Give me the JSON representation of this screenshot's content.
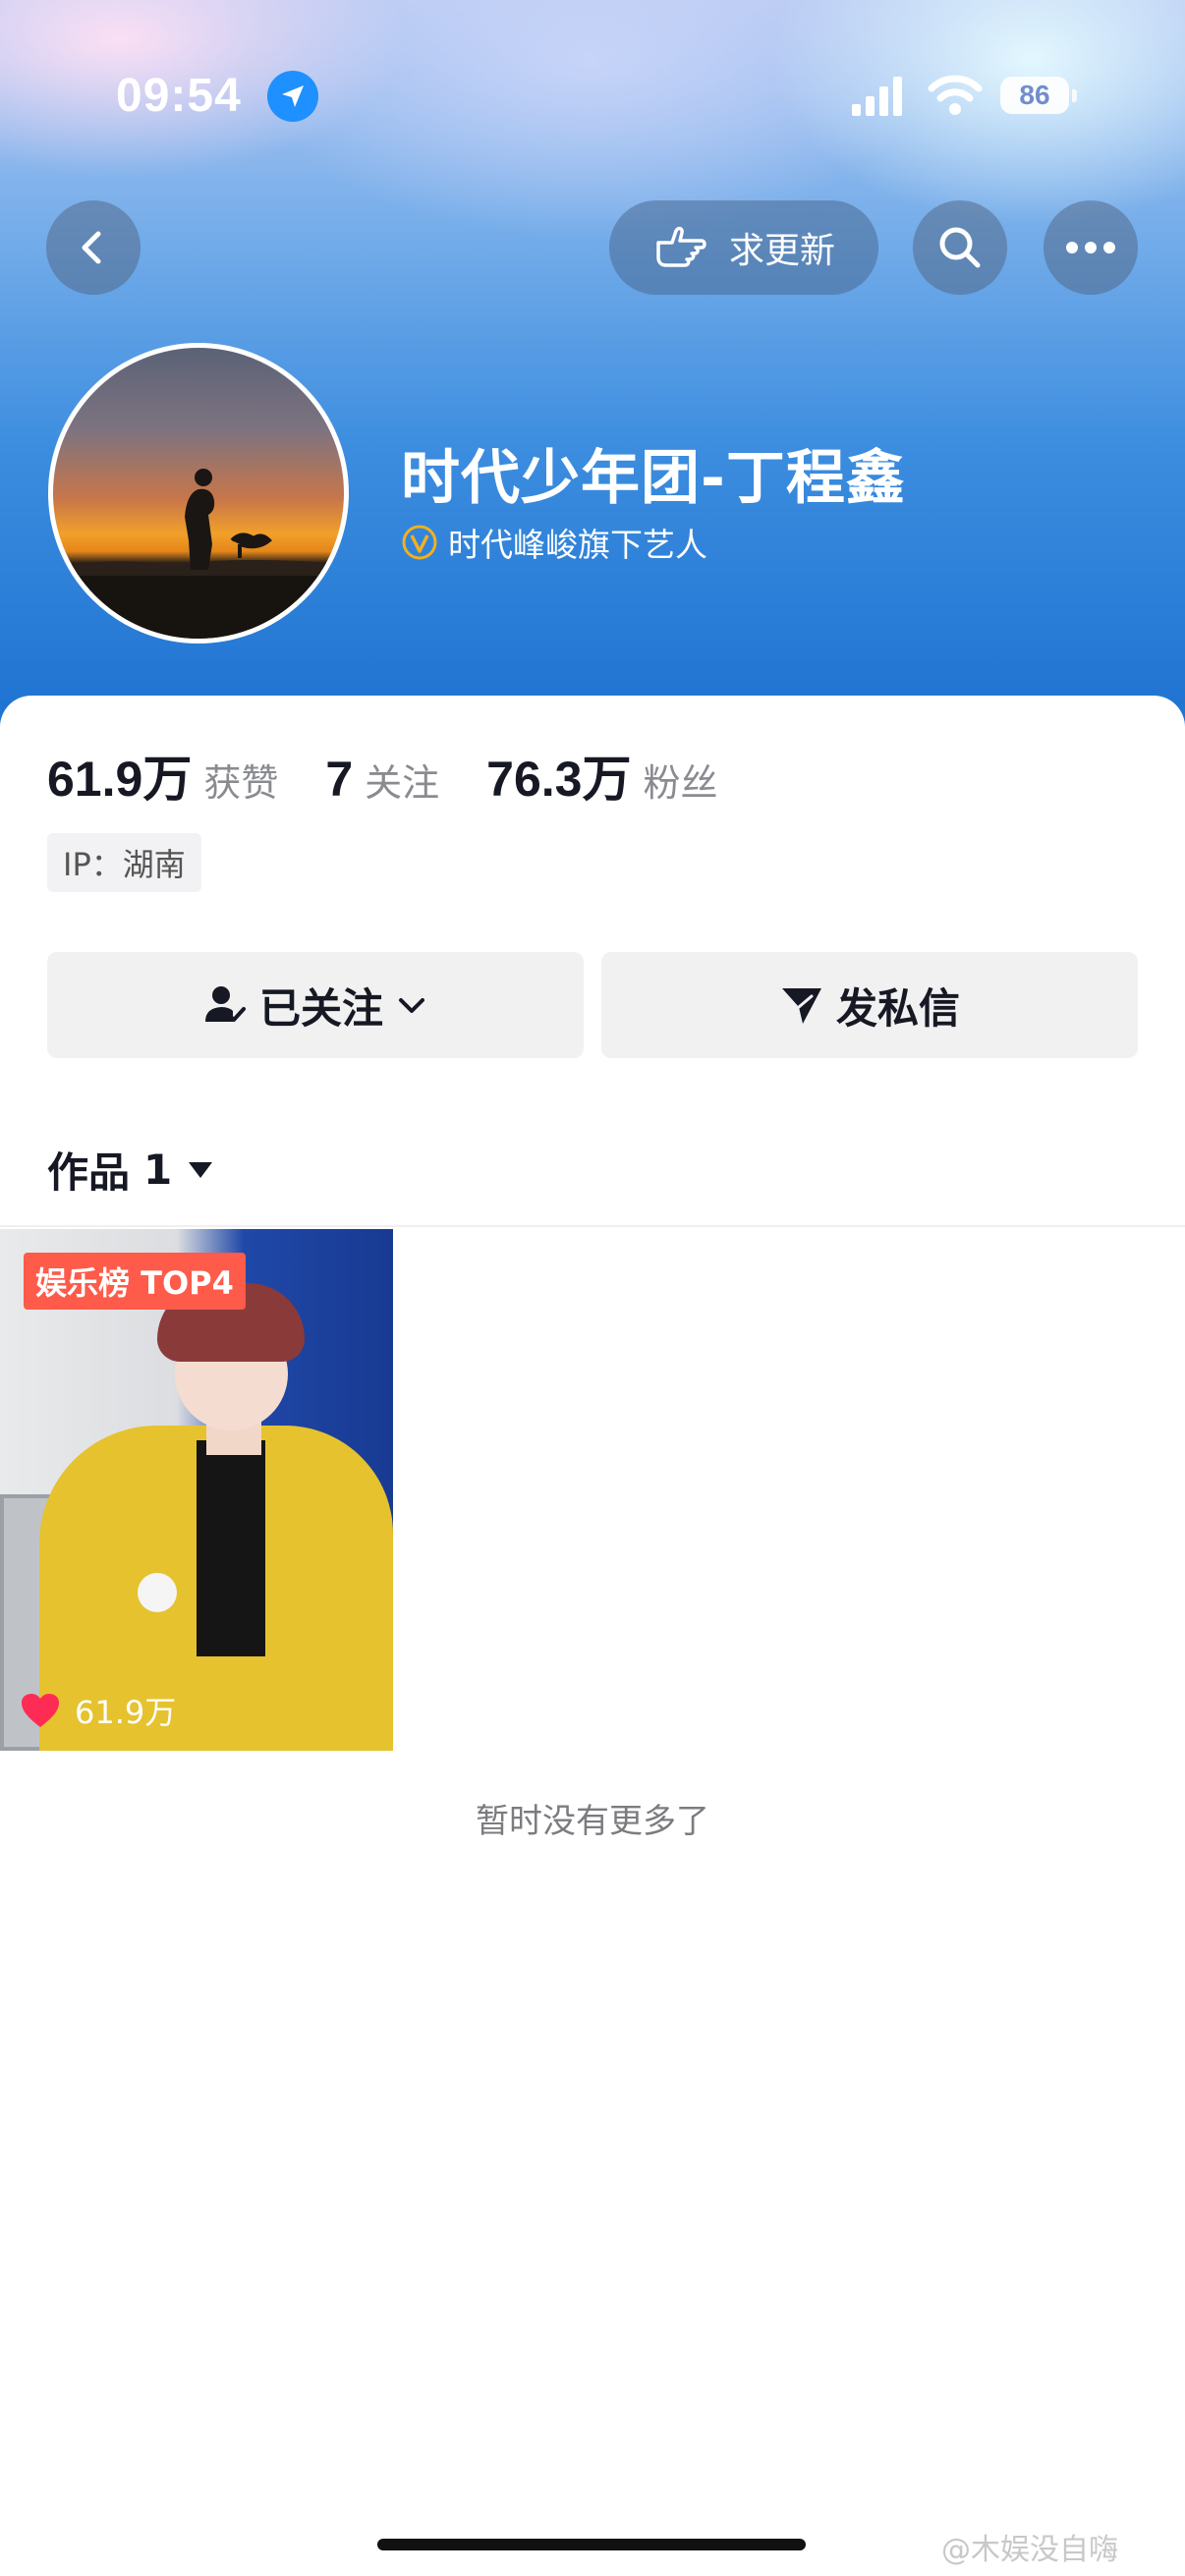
{
  "status_bar": {
    "time": "09:54",
    "battery": "86"
  },
  "top_bar": {
    "request_update_label": "求更新"
  },
  "profile": {
    "nickname": "时代少年团-丁程鑫",
    "verification": "时代峰峻旗下艺人",
    "stats": [
      {
        "value": "61.9万",
        "label": "获赞"
      },
      {
        "value": "7",
        "label": "关注"
      },
      {
        "value": "76.3万",
        "label": "粉丝"
      }
    ],
    "ip": "IP：湖南"
  },
  "actions": {
    "follow_label": "已关注",
    "message_label": "发私信"
  },
  "works_tab": {
    "label": "作品",
    "count": "1"
  },
  "videos": [
    {
      "badge": "娱乐榜 TOP4",
      "likes": "61.9万"
    }
  ],
  "footer": {
    "no_more_text": "暂时没有更多了",
    "watermark": "@木娱没自嗨"
  },
  "colors": {
    "accent_badge": "#fe5b4a",
    "heart": "#fe2c55",
    "verify_gold": "#f2b01e"
  }
}
